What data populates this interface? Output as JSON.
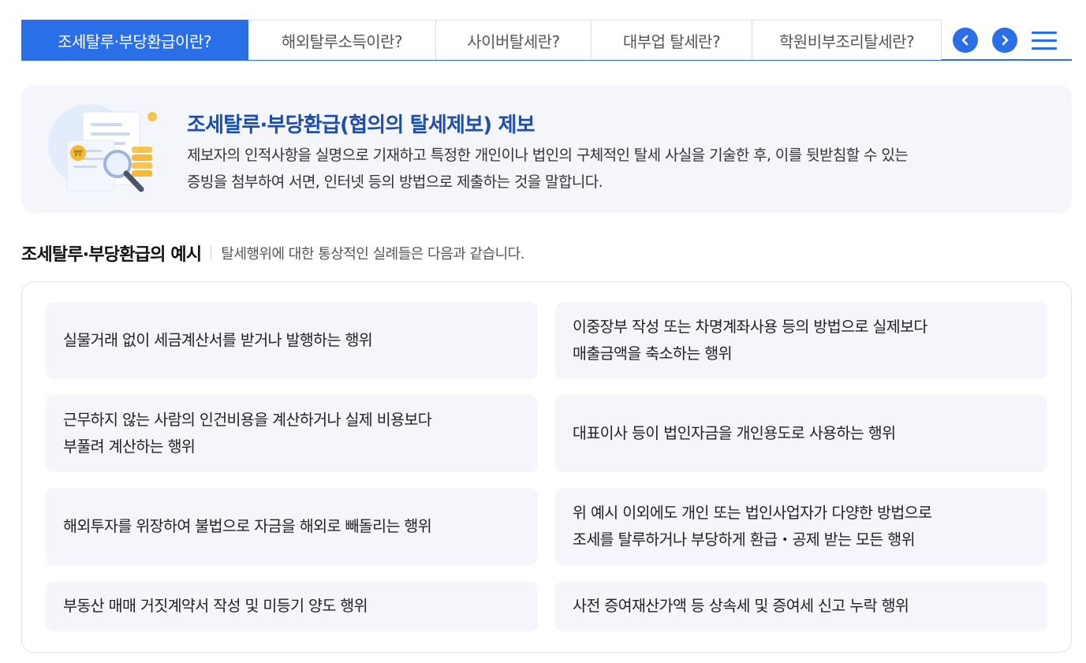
{
  "tabs": {
    "items": [
      {
        "label": "조세탈루·부당환급이란?",
        "active": true
      },
      {
        "label": "해외탈루소득이란?",
        "active": false
      },
      {
        "label": "사이버탈세란?",
        "active": false
      },
      {
        "label": "대부업 탈세란?",
        "active": false
      },
      {
        "label": "학원비부조리탈세란?",
        "active": false
      }
    ],
    "prev_icon": "chevron-left-icon",
    "next_icon": "chevron-right-icon",
    "menu_icon": "hamburger-menu-icon"
  },
  "intro": {
    "title": "조세탈루·부당환급(협의의 탈세제보) 제보",
    "desc_line1": "제보자의 인적사항을 실명으로 기재하고 특정한 개인이나 법인의 구체적인 탈세 사실을 기술한 후, 이를 뒷받침할 수 있는",
    "desc_line2": "증빙을 첨부하여 서면, 인터넷 등의 방법으로 제출하는 것을 말합니다.",
    "illustration_icon": "document-magnifier-coins-icon"
  },
  "examples": {
    "title": "조세탈루·부당환급의 예시",
    "subtitle": "탈세행위에 대한 통상적인 실례들은 다음과 같습니다.",
    "items": [
      {
        "line1": "실물거래 없이 세금계산서를 받거나 발행하는 행위",
        "line2": ""
      },
      {
        "line1": "이중장부 작성 또는 차명계좌사용 등의 방법으로 실제보다",
        "line2": "매출금액을 축소하는 행위"
      },
      {
        "line1": "근무하지 않는 사람의 인건비용을 계산하거나 실제 비용보다",
        "line2": "부풀려 계산하는 행위"
      },
      {
        "line1": "대표이사 등이 법인자금을 개인용도로 사용하는 행위",
        "line2": ""
      },
      {
        "line1": "해외투자를 위장하여 불법으로 자금을 해외로 빼돌리는 행위",
        "line2": ""
      },
      {
        "line1": "위 예시 이외에도 개인 또는 법인사업자가 다양한 방법으로",
        "line2": "조세를 탈루하거나 부당하게 환급・공제 받는 모든 행위"
      },
      {
        "line1": "부동산 매매 거짓계약서 작성 및 미등기 양도 행위",
        "line2": ""
      },
      {
        "line1": "사전 증여재산가액 등 상속세 및 증여세 신고 누락 행위",
        "line2": ""
      }
    ]
  },
  "colors": {
    "accent": "#2b6fe8",
    "title_blue": "#1f4ea8",
    "card_bg": "#f4f6fb"
  }
}
